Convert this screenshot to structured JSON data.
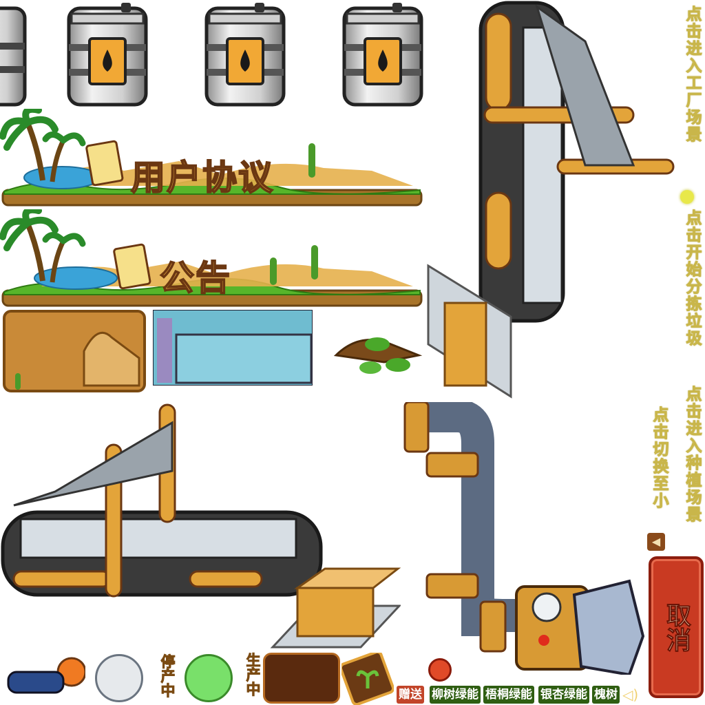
{
  "banners": {
    "agreement": "用户协议",
    "notice": "公告"
  },
  "hints": {
    "enter_factory": "点击进入工厂场景",
    "start_sorting": "点击开始分拣垃圾",
    "enter_plant": "点击进入种植场景",
    "switch_small": "点击切换至小"
  },
  "status": {
    "paused": "停产中",
    "producing": "生产中"
  },
  "cancel_label": "取消",
  "shop": {
    "gift_label": "赠送",
    "trees": [
      "柳树绿能",
      "梧桐绿能",
      "银杏绿能",
      "槐树"
    ]
  },
  "colors": {
    "hint_text": "#f3f0a8",
    "cancel_red": "#c93a22",
    "wood": "#a8742a",
    "gold": "#e3a43a"
  },
  "icons": [
    "oil-barrel-icon",
    "conveyor-belt-icon",
    "pipe-machine-icon",
    "worker-icon",
    "cardboard-box-icon",
    "seedling-card-icon",
    "speaker-icon",
    "arrow-left-icon",
    "red-valve-icon"
  ]
}
